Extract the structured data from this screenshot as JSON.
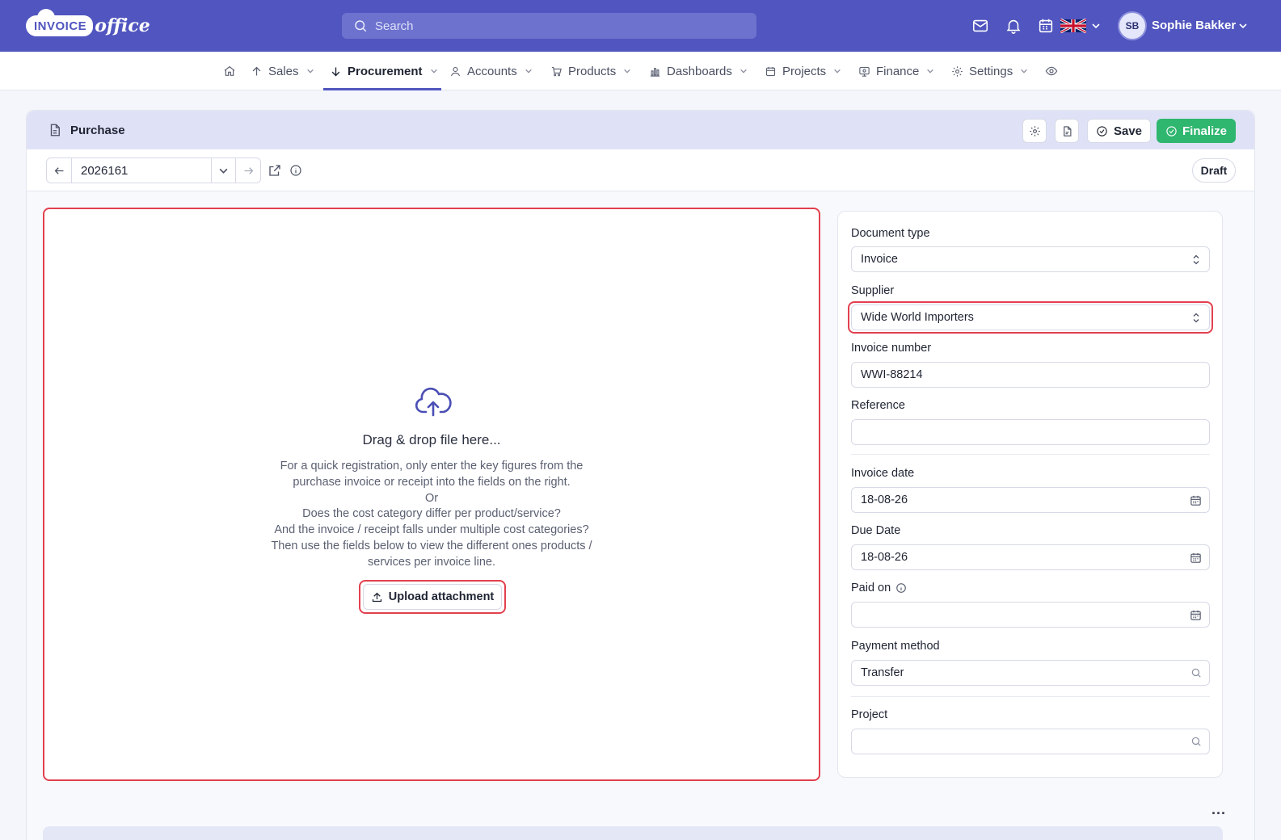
{
  "brand": {
    "logo_main": "INVOICE",
    "logo_sub": "office"
  },
  "search": {
    "placeholder": "Search"
  },
  "user": {
    "initials": "SB",
    "name": "Sophie Bakker"
  },
  "nav": {
    "items": [
      {
        "label": "Sales"
      },
      {
        "label": "Procurement"
      },
      {
        "label": "Accounts"
      },
      {
        "label": "Products"
      },
      {
        "label": "Dashboards"
      },
      {
        "label": "Projects"
      },
      {
        "label": "Finance"
      },
      {
        "label": "Settings"
      }
    ],
    "active": "Procurement"
  },
  "header": {
    "title": "Purchase",
    "save_label": "Save",
    "finalize_label": "Finalize"
  },
  "record": {
    "number": "2026161",
    "status": "Draft"
  },
  "dropzone": {
    "title": "Drag & drop file here...",
    "lines": [
      "For a quick registration, only enter the key figures from the",
      "purchase invoice or receipt into the fields on the right.",
      "Or",
      "Does the cost category differ per product/service?",
      "And the invoice / receipt falls under multiple cost categories?",
      "Then use the fields below to view the different ones products /",
      "services per invoice line."
    ],
    "upload_label": "Upload attachment"
  },
  "form": {
    "document_type": {
      "label": "Document type",
      "value": "Invoice"
    },
    "supplier": {
      "label": "Supplier",
      "value": "Wide World Importers"
    },
    "invoice_number": {
      "label": "Invoice number",
      "value": "WWI-88214"
    },
    "reference": {
      "label": "Reference",
      "value": ""
    },
    "invoice_date": {
      "label": "Invoice date",
      "value": "18-08-26"
    },
    "due_date": {
      "label": "Due Date",
      "value": "18-08-26"
    },
    "paid_on": {
      "label": "Paid on",
      "value": ""
    },
    "payment_method": {
      "label": "Payment method",
      "value": "Transfer"
    },
    "project": {
      "label": "Project",
      "value": ""
    }
  },
  "more_label": "...",
  "colors": {
    "primary": "#5055bf",
    "success": "#2fb66f",
    "highlight": "#e2404e"
  }
}
